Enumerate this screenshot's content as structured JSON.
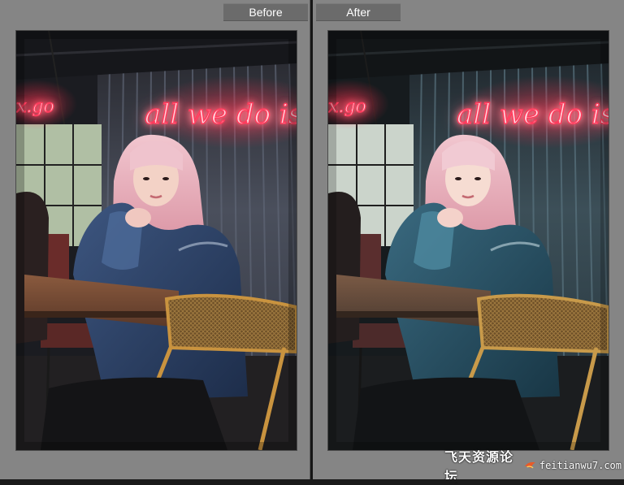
{
  "views": {
    "before": {
      "label": "Before"
    },
    "after": {
      "label": "After"
    }
  },
  "photo": {
    "neon_sign_main": "all we do is bu",
    "neon_sign_left": "x.go",
    "before_tone": "warm",
    "after_tone": "teal"
  },
  "watermark": {
    "name": "飞天资源论坛",
    "url": "feitianwu7.com",
    "logo_icon": "bird-logo-icon"
  },
  "colors": {
    "pane_bg": "#858585",
    "label_bg": "#6b6b6b",
    "neon": "#ff3b5c"
  }
}
